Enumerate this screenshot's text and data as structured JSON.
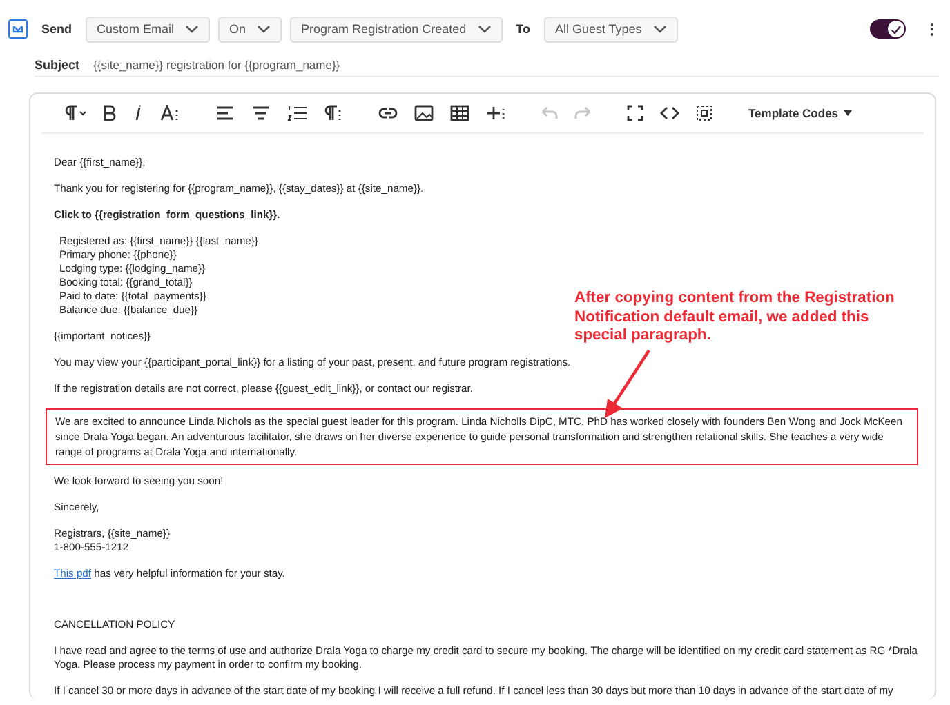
{
  "header": {
    "send_checked": true,
    "send_label": "Send",
    "dropdowns": [
      "Custom Email",
      "On",
      "Program Registration Created"
    ],
    "to_label": "To",
    "to_dropdown": "All Guest Types",
    "toggle_on": true
  },
  "subject": {
    "label": "Subject",
    "value": "{{site_name}} registration for {{program_name}}"
  },
  "toolbar": {
    "buttons": [
      {
        "kind": "paragraph-menu",
        "disabled": false
      },
      {
        "kind": "bold",
        "disabled": false
      },
      {
        "kind": "italic",
        "disabled": false
      },
      {
        "kind": "text-size",
        "disabled": false
      },
      {
        "kind": "align-left",
        "disabled": false
      },
      {
        "kind": "align-center",
        "disabled": false
      },
      {
        "kind": "ordered-list",
        "disabled": false
      },
      {
        "kind": "paragraph-style",
        "disabled": false
      },
      {
        "kind": "link",
        "disabled": false
      },
      {
        "kind": "image",
        "disabled": false
      },
      {
        "kind": "table",
        "disabled": false
      },
      {
        "kind": "insert",
        "disabled": false
      },
      {
        "kind": "undo",
        "disabled": true
      },
      {
        "kind": "redo",
        "disabled": true
      },
      {
        "kind": "fullscreen",
        "disabled": false
      },
      {
        "kind": "code",
        "disabled": false
      },
      {
        "kind": "select-all",
        "disabled": false
      }
    ],
    "template_codes": "Template Codes"
  },
  "body": [
    {
      "kind": "text",
      "text": "Dear {{first_name}},"
    },
    {
      "kind": "text",
      "text": "Thank you for registering for {{program_name}}, {{stay_dates}} at {{site_name}}."
    },
    {
      "kind": "bold",
      "text": "Click to {{registration_form_questions_link}}."
    },
    {
      "kind": "lines",
      "lines": [
        "Registered as: {{first_name}} {{last_name}}",
        "Primary phone: {{phone}}",
        "Lodging type: {{lodging_name}}",
        "Booking total: {{grand_total}}",
        "Paid to date: {{total_payments}}",
        "Balance due: {{balance_due}}"
      ]
    },
    {
      "kind": "text",
      "text": "{{important_notices}}"
    },
    {
      "kind": "text",
      "text": "You may view your {{participant_portal_link}} for a listing of your past, present, and future program registrations."
    },
    {
      "kind": "text",
      "text": "If the registration details are not correct, please {{guest_edit_link}}, or contact our registrar."
    },
    {
      "kind": "highlighted",
      "text": "We are excited to announce Linda Nichols as the special guest leader for this program. Linda Nicholls DipC, MTC, PhD has worked closely with founders Ben Wong and Jock McKeen since Drala Yoga began. An adventurous facilitator, she draws on her diverse experience to guide personal transformation and strengthen relational skills. She teaches a very wide range of programs at Drala Yoga and internationally."
    },
    {
      "kind": "text",
      "text": "We look forward to seeing you soon!"
    },
    {
      "kind": "text",
      "text": "Sincerely,"
    },
    {
      "kind": "lines",
      "lines": [
        "Registrars, {{site_name}}",
        "1-800-555-1212"
      ]
    },
    {
      "kind": "link",
      "link": "This pdf",
      "text": " has very helpful information for your stay."
    },
    {
      "kind": "spacer"
    },
    {
      "kind": "text",
      "text": "CANCELLATION POLICY"
    },
    {
      "kind": "text",
      "text": "I have read and agree to the terms of use and authorize Drala Yoga to charge my credit card to secure my booking. The charge will be identified on my credit card statement as RG *Drala Yoga. Please process my payment in order to confirm my booking."
    },
    {
      "kind": "text",
      "text": "If I cancel 30 or more days in advance of the start date of my booking I will receive a full refund. If I cancel less than 30 days but more than 10 days in advance of the start date of my"
    }
  ],
  "annotation": {
    "text": "After copying content from the Registration Notification default email, we added this special paragraph."
  }
}
